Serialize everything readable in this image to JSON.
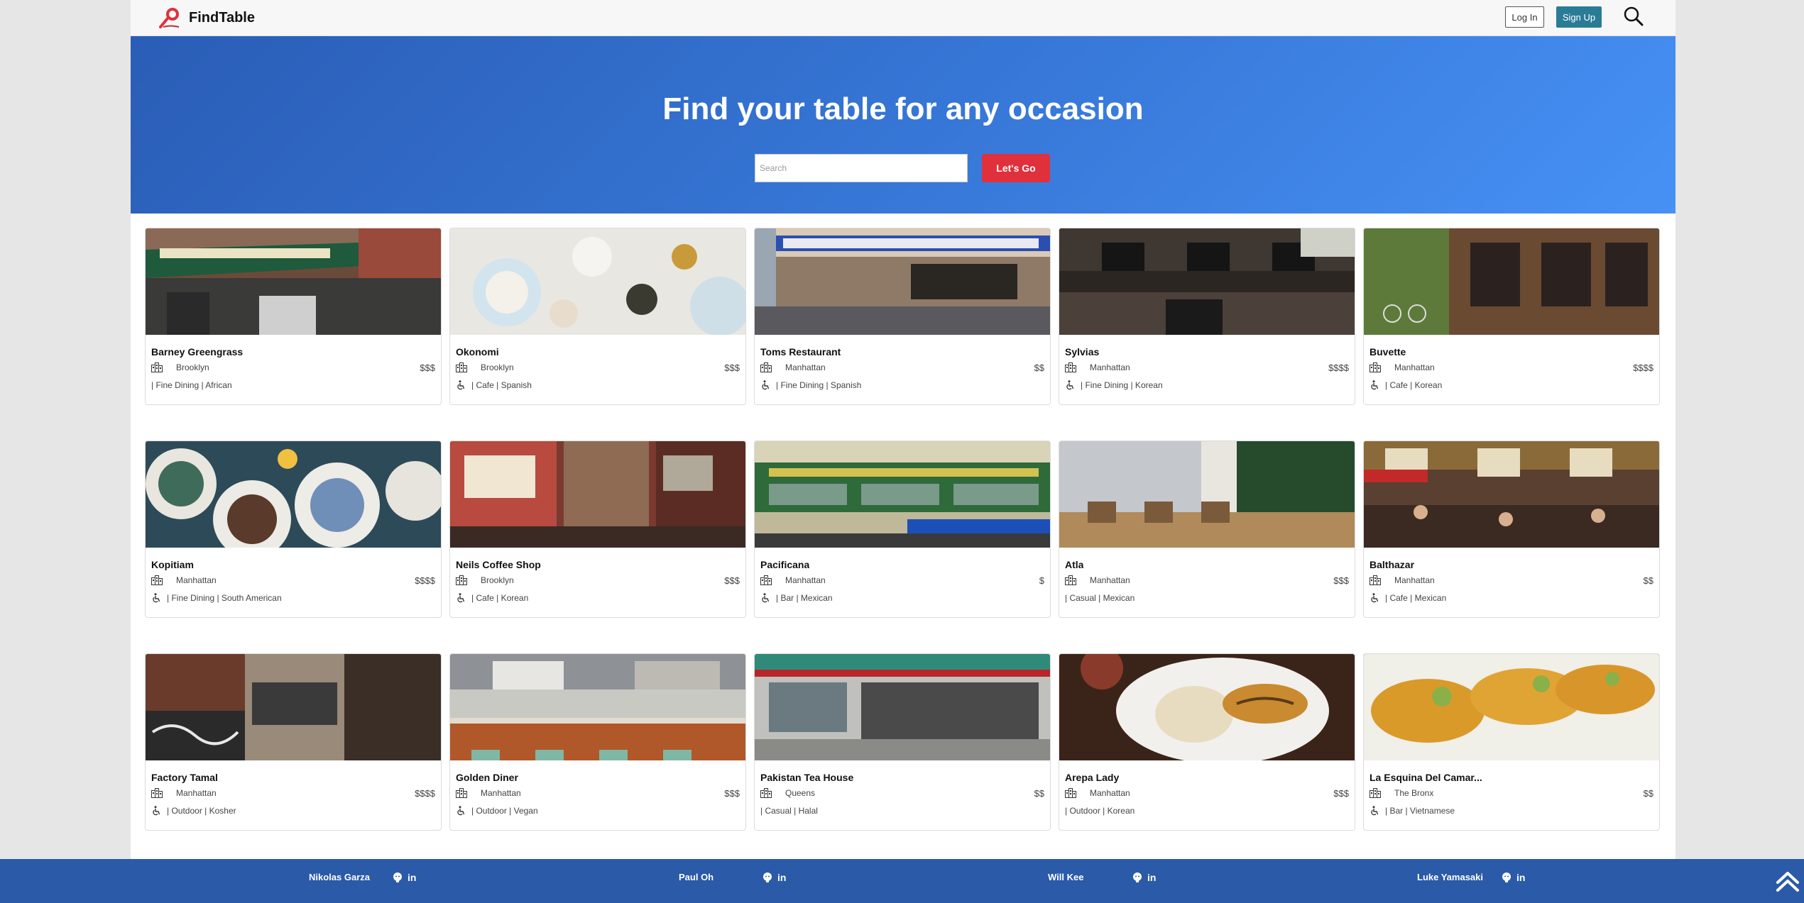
{
  "nav": {
    "brand": "FindTable",
    "login_label": "Log In",
    "signup_label": "Sign Up"
  },
  "hero": {
    "title": "Find your table for any occasion",
    "search_placeholder": "Search",
    "go_label": "Let's Go"
  },
  "restaurants": [
    {
      "name": "Barney Greengrass",
      "location": "Brooklyn",
      "price": "$$$",
      "tags": "| Fine Dining | African",
      "accessible": false,
      "image": "storefront-green-awning"
    },
    {
      "name": "Okonomi",
      "location": "Brooklyn",
      "price": "$$$",
      "tags": "| Cafe | Spanish",
      "accessible": true,
      "image": "table-of-dishes"
    },
    {
      "name": "Toms Restaurant",
      "location": "Manhattan",
      "price": "$$",
      "tags": "| Fine Dining | Spanish",
      "accessible": true,
      "image": "diner-blue-sign"
    },
    {
      "name": "Sylvias",
      "location": "Manhattan",
      "price": "$$$$",
      "tags": "| Fine Dining | Korean",
      "accessible": true,
      "image": "dark-brick-facade"
    },
    {
      "name": "Buvette",
      "location": "Manhattan",
      "price": "$$$$",
      "tags": "| Cafe | Korean",
      "accessible": true,
      "image": "storefront-bicycles"
    },
    {
      "name": "Kopitiam",
      "location": "Manhattan",
      "price": "$$$$",
      "tags": "| Fine Dining | South American",
      "accessible": true,
      "image": "rice-bowls"
    },
    {
      "name": "Neils Coffee Shop",
      "location": "Brooklyn",
      "price": "$$$",
      "tags": "| Cafe | Korean",
      "accessible": true,
      "image": "coffee-shop-sign"
    },
    {
      "name": "Pacificana",
      "location": "Manhattan",
      "price": "$",
      "tags": "| Bar | Mexican",
      "accessible": true,
      "image": "chinatown-building"
    },
    {
      "name": "Atla",
      "location": "Manhattan",
      "price": "$$$",
      "tags": "| Casual | Mexican",
      "accessible": false,
      "image": "bright-dining-room"
    },
    {
      "name": "Balthazar",
      "location": "Manhattan",
      "price": "$$",
      "tags": "| Cafe | Mexican",
      "accessible": true,
      "image": "brasserie-interior"
    },
    {
      "name": "Factory Tamal",
      "location": "Manhattan",
      "price": "$$$$",
      "tags": "| Outdoor | Kosher",
      "accessible": true,
      "image": "graffiti-storefront"
    },
    {
      "name": "Golden Diner",
      "location": "Manhattan",
      "price": "$$$",
      "tags": "| Outdoor | Vegan",
      "accessible": true,
      "image": "diner-counter"
    },
    {
      "name": "Pakistan Tea House",
      "location": "Queens",
      "price": "$$",
      "tags": "| Casual | Halal",
      "accessible": false,
      "image": "tea-house-front"
    },
    {
      "name": "Arepa Lady",
      "location": "Manhattan",
      "price": "$$$",
      "tags": "| Outdoor | Korean",
      "accessible": false,
      "image": "arepa-plate"
    },
    {
      "name": "La Esquina Del Camar...",
      "location": "The Bronx",
      "price": "$$",
      "tags": "| Bar | Vietnamese",
      "accessible": true,
      "image": "fried-empanadas"
    }
  ],
  "footer": {
    "developers": [
      {
        "name": "Nikolas Garza"
      },
      {
        "name": "Paul Oh"
      },
      {
        "name": "Will Kee"
      },
      {
        "name": "Luke Yamasaki"
      }
    ],
    "linkedin_glyph": "in"
  },
  "colors": {
    "hero_start": "#2a5db6",
    "hero_end": "#4791f5",
    "accent_red": "#e0303b",
    "signup_teal": "#2a7c96",
    "footer_blue": "#2a5aa8"
  }
}
